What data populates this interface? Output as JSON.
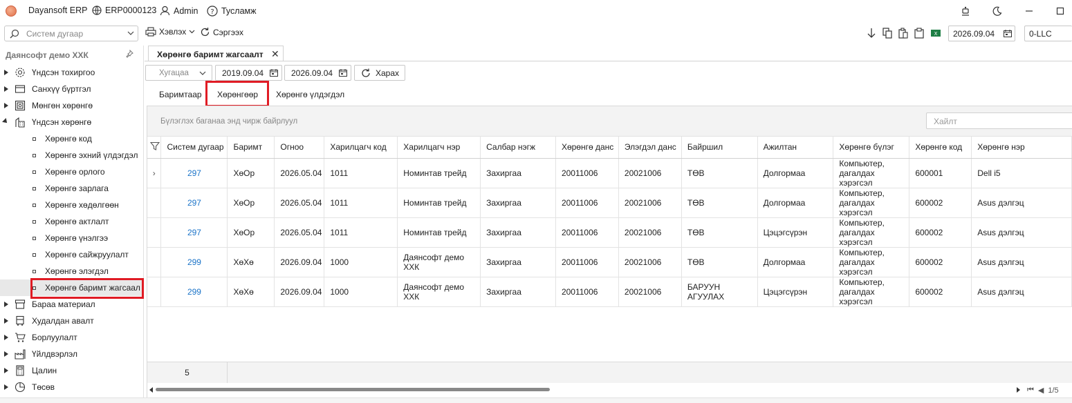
{
  "titlebar": {
    "app_name": "Dayansoft ERP",
    "db_code": "ERP0000123",
    "user": "Admin",
    "help": "Тусламж"
  },
  "toolbar": {
    "search_placeholder": "Систем дугаар",
    "print_label": "Хэвлэх",
    "refresh_label": "Сэргээх",
    "work_date": "2026.09.04",
    "company_code": "0-LLC"
  },
  "sidebar": {
    "company": "Даянсофт демо ХХК",
    "items": [
      {
        "label": "Үндсэн тохиргоо",
        "icon": "gear-icon",
        "expanded": false
      },
      {
        "label": "Санхүү бүртгэл",
        "icon": "ledger-icon",
        "expanded": false
      },
      {
        "label": "Мөнгөн хөрөнгө",
        "icon": "money-icon",
        "expanded": false
      },
      {
        "label": "Үндсэн хөрөнгө",
        "icon": "building-icon",
        "expanded": true
      }
    ],
    "sub_items": [
      "Хөрөнгө код",
      "Хөрөнгө эхний үлдэгдэл",
      "Хөрөнгө орлого",
      "Хөрөнгө зарлага",
      "Хөрөнгө хөдөлгөөн",
      "Хөрөнгө актлалт",
      "Хөрөнгө үнэлгээ",
      "Хөрөнгө сайжруулалт",
      "Хөрөнгө элэгдэл",
      "Хөрөнгө баримт жагсаал"
    ],
    "items_after": [
      {
        "label": "Бараа материал",
        "icon": "box-icon"
      },
      {
        "label": "Худалдан авалт",
        "icon": "cart-icon"
      },
      {
        "label": "Борлуулалт",
        "icon": "sales-icon"
      },
      {
        "label": "Үйлдвэрлэл",
        "icon": "factory-icon"
      },
      {
        "label": "Цалин",
        "icon": "calculator-icon"
      },
      {
        "label": "Төсөв",
        "icon": "pie-icon"
      }
    ]
  },
  "main": {
    "doc_tab": "Хөрөнгө баримт жагсаалт",
    "filter": {
      "period_placeholder": "Хугацаа",
      "date_from": "2019.09.04",
      "date_to": "2026.09.04",
      "view_label": "Харах"
    },
    "subtabs": [
      "Баримтаар",
      "Хөрөнгөөр",
      "Хөрөнгө үлдэгдэл"
    ],
    "group_hint": "Бүлэглэх баганаа энд чирж байрлуул",
    "search_placeholder": "Хайлт",
    "columns": [
      "Систем дугаар",
      "Баримт",
      "Огноо",
      "Харилцагч код",
      "Харилцагч нэр",
      "Салбар нэгж",
      "Хөрөнгө данс",
      "Элэгдэл данс",
      "Байршил",
      "Ажилтан",
      "Хөрөнгө бүлэг",
      "Хөрөнгө код",
      "Хөрөнгө нэр"
    ],
    "rows": [
      [
        "297",
        "ХөОр",
        "2026.05.04",
        "1011",
        "Номинтав трейд",
        "Захиргаа",
        "20011006",
        "20021006",
        "ТӨВ",
        "Долгормаа",
        "Компьютер, дагалдах хэрэгсэл",
        "600001",
        "Dell i5"
      ],
      [
        "297",
        "ХөОр",
        "2026.05.04",
        "1011",
        "Номинтав трейд",
        "Захиргаа",
        "20011006",
        "20021006",
        "ТӨВ",
        "Долгормаа",
        "Компьютер, дагалдах хэрэгсэл",
        "600002",
        "Asus дэлгэц"
      ],
      [
        "297",
        "ХөОр",
        "2026.05.04",
        "1011",
        "Номинтав трейд",
        "Захиргаа",
        "20011006",
        "20021006",
        "ТӨВ",
        "Цэцэгсүрэн",
        "Компьютер, дагалдах хэрэгсэл",
        "600002",
        "Asus дэлгэц"
      ],
      [
        "299",
        "ХөХө",
        "2026.09.04",
        "1000",
        "Даянсофт демо ХХК",
        "Захиргаа",
        "20011006",
        "20021006",
        "ТӨВ",
        "Долгормаа",
        "Компьютер, дагалдах хэрэгсэл",
        "600002",
        "Asus дэлгэц"
      ],
      [
        "299",
        "ХөХө",
        "2026.09.04",
        "1000",
        "Даянсофт демо ХХК",
        "Захиргаа",
        "20011006",
        "20021006",
        "БАРУУН АГУУЛАХ",
        "Цэцэгсүрэн",
        "Компьютер, дагалдах хэрэгсэл",
        "600002",
        "Asus дэлгэц"
      ]
    ],
    "row_count": "5",
    "page_info": "1/5"
  },
  "colors": {
    "link": "#1a73c8",
    "highlight": "#e01b24"
  }
}
